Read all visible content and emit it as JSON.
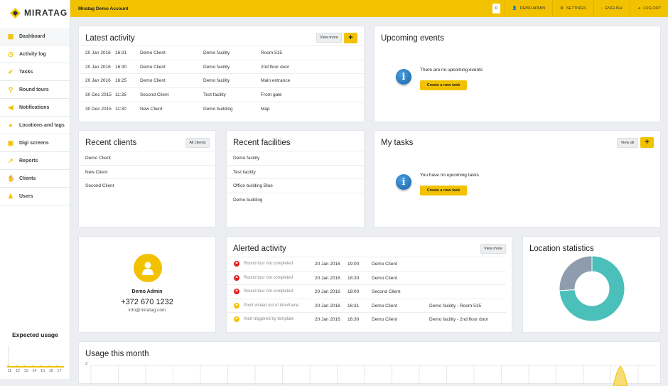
{
  "brand": {
    "name": "MIRATAG"
  },
  "nav": [
    {
      "label": "Dashboard",
      "icon": "grid-icon"
    },
    {
      "label": "Activity log",
      "icon": "clock-icon"
    },
    {
      "label": "Tasks",
      "icon": "check-icon"
    },
    {
      "label": "Round tours",
      "icon": "route-icon"
    },
    {
      "label": "Notifications",
      "icon": "megaphone-icon"
    },
    {
      "label": "Locations and tags",
      "icon": "map-pin-icon"
    },
    {
      "label": "Digi screens",
      "icon": "screen-icon"
    },
    {
      "label": "Reports",
      "icon": "chart-icon"
    },
    {
      "label": "Clients",
      "icon": "handshake-icon"
    },
    {
      "label": "Users",
      "icon": "users-icon"
    }
  ],
  "expected_usage": {
    "title": "Expected usage",
    "ticks": [
      "11",
      "12",
      "13",
      "14",
      "15",
      "16",
      "17"
    ]
  },
  "topbar": {
    "account": "Miratag Demo Account",
    "badge": "0",
    "user": "DEMO ADMIN",
    "settings": "SETTINGS",
    "language": "ENGLISH",
    "logout": "LOG OUT"
  },
  "latest_activity": {
    "title": "Latest activity",
    "view_more": "View more",
    "plus": "+",
    "rows": [
      [
        "20 Jan 2016",
        "16:31",
        "Demo Client",
        "Demo facility",
        "Room 515"
      ],
      [
        "20 Jan 2016",
        "16:30",
        "Demo Client",
        "Demo facility",
        "2nd floor door"
      ],
      [
        "20 Jan 2016",
        "16:25",
        "Demo Client",
        "Demo facility",
        "Main entrance"
      ],
      [
        "30 Dec 2015",
        "11:35",
        "Second Client",
        "Test facility",
        "Front gate"
      ],
      [
        "30 Dec 2015",
        "11:30",
        "New Client",
        "Demo building",
        "Map"
      ]
    ]
  },
  "upcoming_events": {
    "title": "Upcoming events",
    "message": "There are no upcoming events",
    "button": "Create a new task"
  },
  "recent_clients": {
    "title": "Recent clients",
    "button": "All clients",
    "items": [
      "Demo Client",
      "New Client",
      "Second Client"
    ]
  },
  "recent_facilities": {
    "title": "Recent facilities",
    "items": [
      "Demo facility",
      "Test facility",
      "Office building Blue",
      "Demo building"
    ]
  },
  "my_tasks": {
    "title": "My tasks",
    "view_all": "View all",
    "plus": "+",
    "message": "You have no upcoming tasks",
    "button": "Create a new task"
  },
  "profile": {
    "name": "Demo Admin",
    "phone": "+372 670 1232",
    "email": "info@miratag.com"
  },
  "alerted_activity": {
    "title": "Alerted activity",
    "view_more": "View more",
    "rows": [
      {
        "status": "red",
        "text": "Round tour not completed",
        "date": "20 Jan 2016",
        "time": "19:00",
        "client": "Demo Client",
        "location": ""
      },
      {
        "status": "red",
        "text": "Round tour not completed",
        "date": "20 Jan 2016",
        "time": "18:30",
        "client": "Demo Client",
        "location": ""
      },
      {
        "status": "red",
        "text": "Round tour not completed",
        "date": "20 Jan 2016",
        "time": "18:00",
        "client": "Second Client",
        "location": ""
      },
      {
        "status": "yellow",
        "text": "Point visited out of timeframe",
        "date": "20 Jan 2016",
        "time": "16:31",
        "client": "Demo Client",
        "location": "Demo facility - Room 515"
      },
      {
        "status": "yellow",
        "text": "Alert triggered by template",
        "date": "20 Jan 2016",
        "time": "16:30",
        "client": "Demo Client",
        "location": "Demo facility - 2nd floor door"
      }
    ]
  },
  "location_statistics": {
    "title": "Location statistics"
  },
  "usage": {
    "title": "Usage this month",
    "y_tick": "3"
  },
  "chart_data": {
    "type": "pie",
    "title": "Location statistics",
    "values": [
      74,
      26
    ],
    "colors": [
      "#4bbfba",
      "#8f9cad"
    ]
  }
}
